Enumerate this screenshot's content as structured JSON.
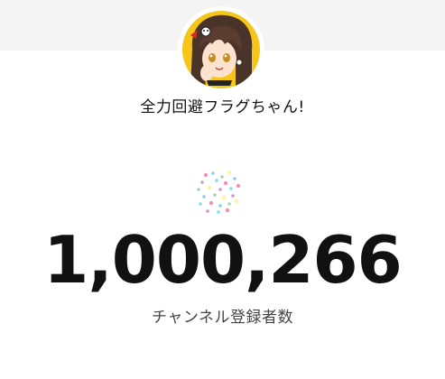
{
  "channel": {
    "name": "全力回避フラグちゃん!",
    "avatar_icon": "avatar-anime-girl"
  },
  "subscribers": {
    "count": "1,000,266",
    "label": "チャンネル登録者数"
  },
  "decor": {
    "icon": "confetti-icon",
    "colors": [
      "#f48fb1",
      "#90caf9",
      "#a5d6a7",
      "#fff59d",
      "#ce93d8",
      "#80deea"
    ]
  },
  "colors": {
    "top_band": "#f4f4f4",
    "text_primary": "#111111",
    "text_secondary": "#444444",
    "avatar_bg": "#f5c518"
  }
}
